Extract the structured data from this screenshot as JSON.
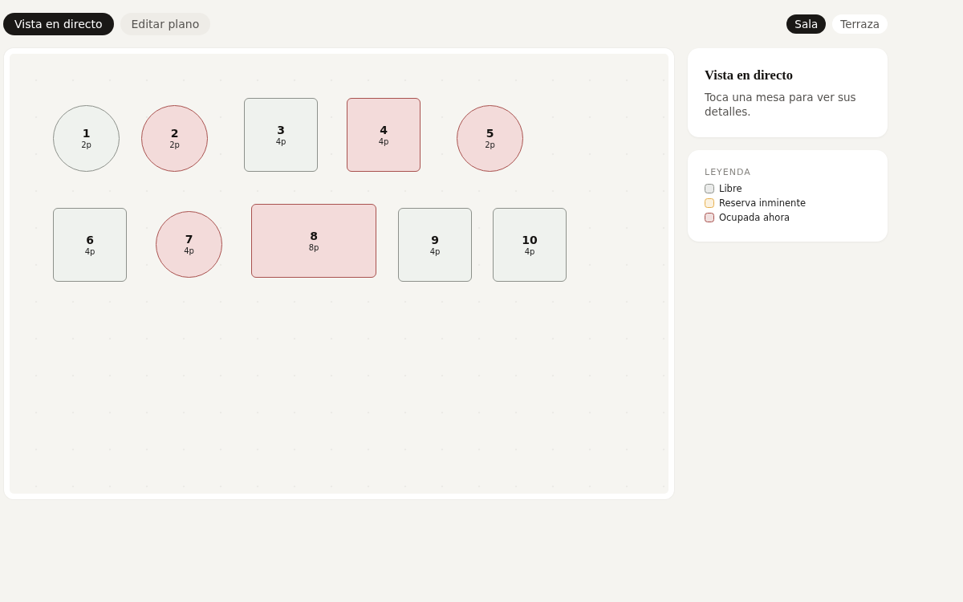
{
  "mode_tabs": [
    {
      "label": "Vista en directo",
      "selected": true
    },
    {
      "label": "Editar plano",
      "selected": false
    }
  ],
  "room_tabs": [
    {
      "label": "Sala",
      "selected": true
    },
    {
      "label": "Terraza",
      "selected": false
    }
  ],
  "tables": [
    {
      "number": "1",
      "seats": "2p",
      "kind": "round",
      "occupied": false
    },
    {
      "number": "2",
      "seats": "2p",
      "kind": "round",
      "occupied": true
    },
    {
      "number": "3",
      "seats": "4p",
      "kind": "rect",
      "occupied": false
    },
    {
      "number": "4",
      "seats": "4p",
      "kind": "rect",
      "occupied": true
    },
    {
      "number": "5",
      "seats": "2p",
      "kind": "round",
      "occupied": true
    },
    {
      "number": "6",
      "seats": "4p",
      "kind": "rect",
      "occupied": false
    },
    {
      "number": "7",
      "seats": "4p",
      "kind": "round",
      "occupied": true
    },
    {
      "number": "8",
      "seats": "8p",
      "kind": "rect",
      "occupied": true
    },
    {
      "number": "9",
      "seats": "4p",
      "kind": "rect",
      "occupied": false
    },
    {
      "number": "10",
      "seats": "4p",
      "kind": "rect",
      "occupied": false
    }
  ],
  "info_card": {
    "title": "Vista en directo",
    "text": "Toca una mesa para ver sus detalles."
  },
  "legend": {
    "heading": "LEYENDA",
    "items": [
      {
        "label": "Libre",
        "color": "#8d918b"
      },
      {
        "label": "Reserva inminente",
        "color": "#e6b04e"
      },
      {
        "label": "Ocupada ahora",
        "color": "#a9524f"
      }
    ]
  }
}
